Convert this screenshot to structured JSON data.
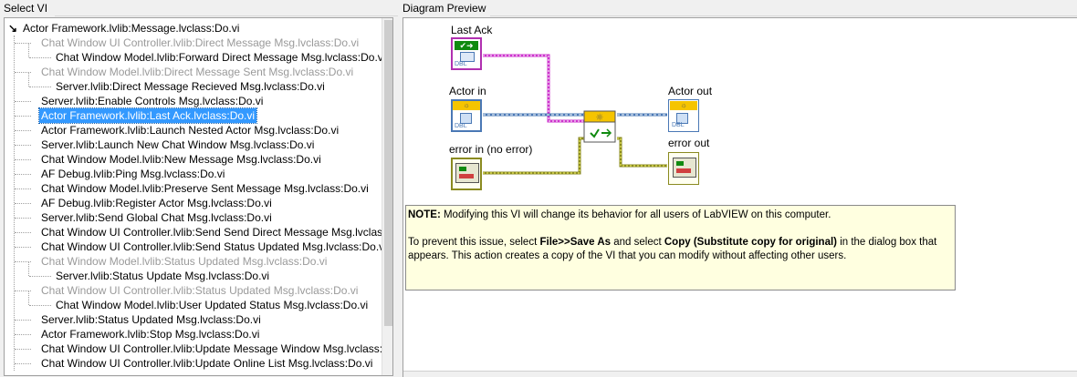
{
  "left_panel": {
    "title": "Select VI",
    "root_label": "Actor Framework.lvlib:Message.lvclass:Do.vi",
    "items": [
      {
        "label": "Chat Window UI Controller.lvlib:Direct Message Msg.lvclass:Do.vi",
        "grayed": true,
        "level": 1
      },
      {
        "label": "Chat Window Model.lvlib:Forward Direct Message Msg.lvclass:Do.vi",
        "grayed": false,
        "level": 2
      },
      {
        "label": "Chat Window Model.lvlib:Direct Message Sent Msg.lvclass:Do.vi",
        "grayed": true,
        "level": 1
      },
      {
        "label": "Server.lvlib:Direct Message Recieved Msg.lvclass:Do.vi",
        "grayed": false,
        "level": 2
      },
      {
        "label": "Server.lvlib:Enable Controls Msg.lvclass:Do.vi",
        "grayed": false,
        "level": 1
      },
      {
        "label": "Actor Framework.lvlib:Last Ack.lvclass:Do.vi",
        "grayed": false,
        "level": 1,
        "selected": true
      },
      {
        "label": "Actor Framework.lvlib:Launch Nested Actor Msg.lvclass:Do.vi",
        "grayed": false,
        "level": 1
      },
      {
        "label": "Server.lvlib:Launch New Chat Window Msg.lvclass:Do.vi",
        "grayed": false,
        "level": 1
      },
      {
        "label": "Chat Window Model.lvlib:New Message Msg.lvclass:Do.vi",
        "grayed": false,
        "level": 1
      },
      {
        "label": "AF Debug.lvlib:Ping Msg.lvclass:Do.vi",
        "grayed": false,
        "level": 1
      },
      {
        "label": "Chat Window Model.lvlib:Preserve Sent Message Msg.lvclass:Do.vi",
        "grayed": false,
        "level": 1
      },
      {
        "label": "AF Debug.lvlib:Register Actor Msg.lvclass:Do.vi",
        "grayed": false,
        "level": 1
      },
      {
        "label": "Server.lvlib:Send Global Chat Msg.lvclass:Do.vi",
        "grayed": false,
        "level": 1
      },
      {
        "label": "Chat Window UI Controller.lvlib:Send Send Direct Message Msg.lvclass:Do.vi",
        "grayed": false,
        "level": 1
      },
      {
        "label": "Chat Window UI Controller.lvlib:Send Status Updated Msg.lvclass:Do.vi",
        "grayed": false,
        "level": 1
      },
      {
        "label": "Chat Window Model.lvlib:Status Updated Msg.lvclass:Do.vi",
        "grayed": true,
        "level": 1
      },
      {
        "label": "Server.lvlib:Status Update Msg.lvclass:Do.vi",
        "grayed": false,
        "level": 2
      },
      {
        "label": "Chat Window UI Controller.lvlib:Status Updated Msg.lvclass:Do.vi",
        "grayed": true,
        "level": 1
      },
      {
        "label": "Chat Window Model.lvlib:User Updated Status Msg.lvclass:Do.vi",
        "grayed": false,
        "level": 2
      },
      {
        "label": "Server.lvlib:Status Updated Msg.lvclass:Do.vi",
        "grayed": false,
        "level": 1
      },
      {
        "label": "Actor Framework.lvlib:Stop Msg.lvclass:Do.vi",
        "grayed": false,
        "level": 1
      },
      {
        "label": "Chat Window UI Controller.lvlib:Update Message Window Msg.lvclass:Do.vi",
        "grayed": false,
        "level": 1
      },
      {
        "label": "Chat Window UI Controller.lvlib:Update Online List Msg.lvclass:Do.vi",
        "grayed": false,
        "level": 1
      }
    ]
  },
  "right_panel": {
    "title": "Diagram Preview",
    "terminals": {
      "last_ack": "Last Ack",
      "actor_in": "Actor in",
      "error_in": "error in (no error)",
      "actor_out": "Actor out",
      "error_out": "error out",
      "badge_text": "DBL"
    },
    "note": {
      "label": "NOTE:",
      "line1": " Modifying this VI will change its behavior for all users of LabVIEW on this computer.",
      "p2_prefix": "To prevent this issue, select ",
      "file_menu": "File>>Save As",
      "p2_mid": " and select ",
      "copy_option": "Copy (Substitute copy for original)",
      "p2_suffix": " in the dialog box that appears. This action creates a copy of the VI that you can modify without affecting other users."
    }
  },
  "colors": {
    "selection": "#3399ff",
    "grayed_text": "#9a9a9a",
    "class_wire_pink": "#cc33cc",
    "class_wire_blue": "#4a78b5",
    "error_wire": "#8a8a20",
    "note_background": "#ffffe0"
  }
}
